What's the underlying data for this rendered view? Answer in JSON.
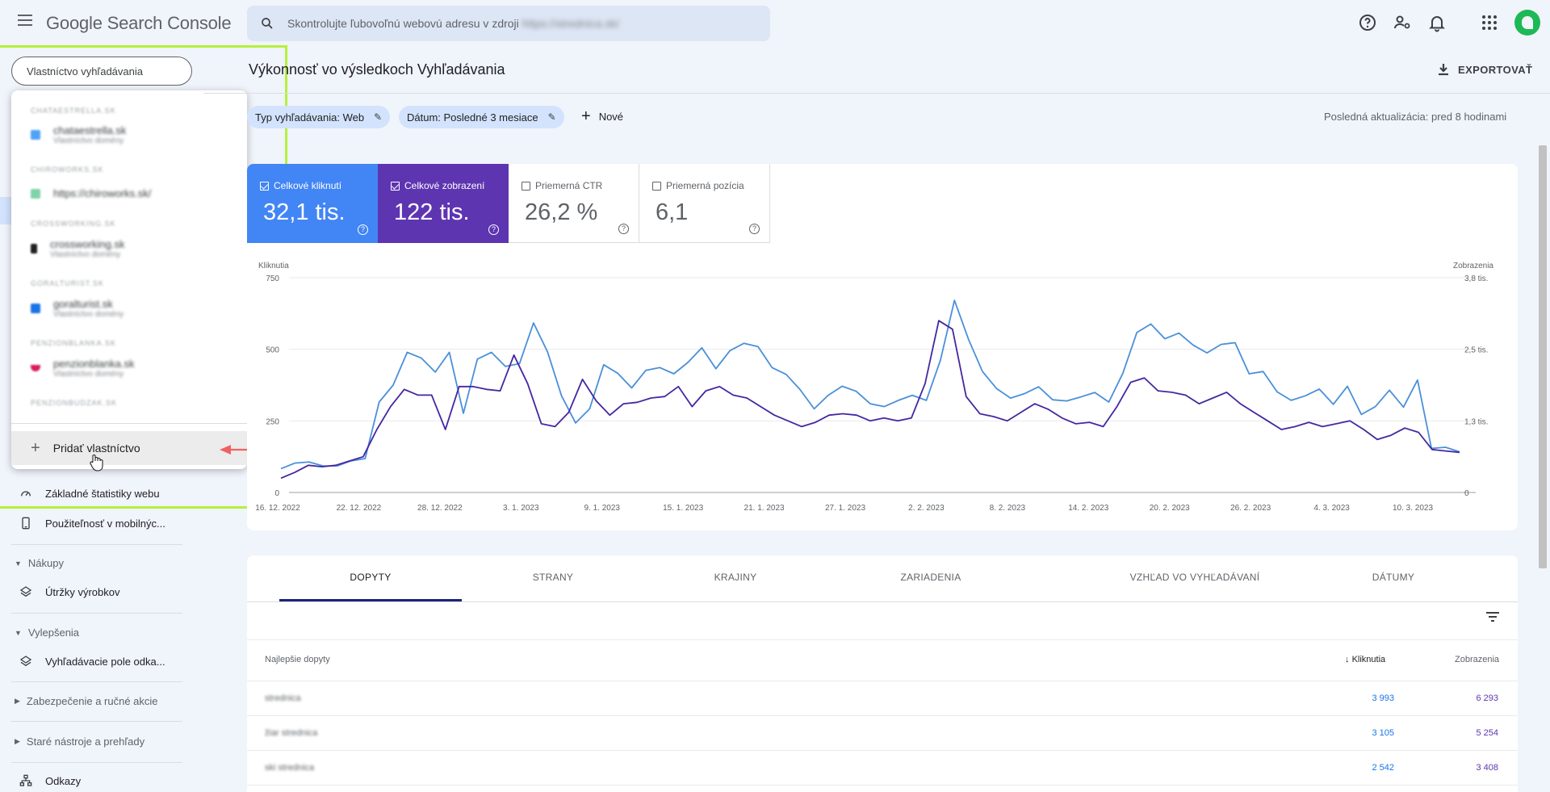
{
  "app": {
    "logo_google": "Google",
    "logo_product": "Search Console"
  },
  "search": {
    "placeholder": "Skontrolujte ľubovoľnú webovú adresu v zdroji",
    "domain": "https://strednica.sk/"
  },
  "sidebar": {
    "property_select": "Vlastníctvo vyhľadávania",
    "items": [
      {
        "label": "Základné štatistiky webu",
        "icon": "speed-icon"
      },
      {
        "label": "Použiteľnosť v mobilnýc...",
        "icon": "phone-icon"
      }
    ],
    "sections": [
      {
        "label": "Nákupy",
        "expanded": true,
        "items": [
          {
            "label": "Útržky výrobkov",
            "icon": "layers-icon"
          }
        ]
      },
      {
        "label": "Vylepšenia",
        "expanded": true,
        "items": [
          {
            "label": "Vyhľadávacie pole odka...",
            "icon": "layers-icon"
          }
        ]
      },
      {
        "label": "Zabezpečenie a ručné akcie",
        "expanded": false,
        "items": []
      },
      {
        "label": "Staré nástroje a prehľady",
        "expanded": false,
        "items": []
      }
    ],
    "bottom_item": {
      "label": "Odkazy",
      "icon": "sitemap-icon"
    }
  },
  "dropdown": {
    "groups": [
      {
        "header": "CHATAESTRELLA.SK",
        "name": "chataestrella.sk",
        "sub": "Vlastníctvo domény",
        "color": "#4fa3f7"
      },
      {
        "header": "CHIROWORKS.SK",
        "name": "https://chiroworks.sk/",
        "sub": "",
        "color": "#34a853"
      },
      {
        "header": "CROSSWORKING.SK",
        "name": "crossworking.sk",
        "sub": "Vlastníctvo domény",
        "color": "#202124"
      },
      {
        "header": "GORALTURIST.SK",
        "name": "goralturist.sk",
        "sub": "Vlastníctvo domény",
        "color": "#1a73e8"
      },
      {
        "header": "PENZIONBLANKA.SK",
        "name": "penzionblanka.sk",
        "sub": "Vlastníctvo domény",
        "color": "#c2185b"
      },
      {
        "header": "PENZIONBUDZAK.SK",
        "name": "",
        "sub": "",
        "color": "#9aa0a6"
      }
    ],
    "add_label": "Pridať vlastníctvo"
  },
  "main": {
    "title": "Výkonnosť vo výsledkoch Vyhľadávania",
    "export": "EXPORTOVAŤ",
    "filters": [
      {
        "label": "Typ vyhľadávania: Web"
      },
      {
        "label": "Dátum: Posledné 3 mesiace"
      }
    ],
    "new_label": "Nové",
    "last_update": "Posledná aktualizácia: pred 8 hodinami"
  },
  "metrics": [
    {
      "label": "Celkové kliknutí",
      "value": "32,1 tis.",
      "checked": true
    },
    {
      "label": "Celkové zobrazení",
      "value": "122 tis.",
      "checked": true
    },
    {
      "label": "Priemerná CTR",
      "value": "26,2 %",
      "checked": false
    },
    {
      "label": "Priemerná pozícia",
      "value": "6,1",
      "checked": false
    }
  ],
  "chart_data": {
    "type": "line",
    "left_axis_label": "Kliknutia",
    "right_axis_label": "Zobrazenia",
    "left_ticks": [
      "0",
      "250",
      "500",
      "750"
    ],
    "right_ticks": [
      "0",
      "1,3 tis.",
      "2,5 tis.",
      "3,8 tis."
    ],
    "ylim_left": [
      0,
      750
    ],
    "ylim_right": [
      0,
      3800
    ],
    "x_labels": [
      "16. 12. 2022",
      "22. 12. 2022",
      "28. 12. 2022",
      "3. 1. 2023",
      "9. 1. 2023",
      "15. 1. 2023",
      "21. 1. 2023",
      "27. 1. 2023",
      "2. 2. 2023",
      "8. 2. 2023",
      "14. 2. 2023",
      "20. 2. 2023",
      "26. 2. 2023",
      "4. 3. 2023",
      "10. 3. 2023"
    ],
    "grid": true,
    "series": [
      {
        "name": "Zobrazenia",
        "color": "#4a90d9",
        "axis": "right",
        "values": [
          420,
          520,
          540,
          470,
          470,
          560,
          600,
          1600,
          1900,
          2480,
          2380,
          2130,
          2480,
          1400,
          2360,
          2480,
          2230,
          2280,
          3000,
          2490,
          1710,
          1230,
          1480,
          2260,
          2110,
          1850,
          2160,
          2210,
          2100,
          2300,
          2560,
          2190,
          2510,
          2640,
          2580,
          2210,
          2090,
          1820,
          1480,
          1720,
          1880,
          1790,
          1570,
          1520,
          1630,
          1720,
          1630,
          2340,
          3400,
          2710,
          2140,
          1840,
          1670,
          1750,
          1870,
          1640,
          1620,
          1690,
          1770,
          1600,
          2110,
          2830,
          2980,
          2720,
          2820,
          2610,
          2470,
          2620,
          2650,
          2100,
          2140,
          1780,
          1630,
          1710,
          1830,
          1560,
          1880,
          1380,
          1520,
          1810,
          1510,
          1990,
          780,
          800,
          720
        ]
      },
      {
        "name": "Kliknutia",
        "color": "#4527a0",
        "axis": "left",
        "values": [
          50,
          70,
          95,
          90,
          95,
          110,
          125,
          220,
          300,
          360,
          340,
          340,
          220,
          370,
          370,
          360,
          355,
          480,
          380,
          240,
          230,
          280,
          395,
          320,
          270,
          310,
          315,
          330,
          335,
          370,
          300,
          355,
          370,
          340,
          330,
          300,
          270,
          250,
          230,
          245,
          270,
          275,
          270,
          250,
          260,
          250,
          260,
          380,
          600,
          570,
          335,
          275,
          265,
          250,
          280,
          310,
          290,
          260,
          240,
          245,
          230,
          300,
          385,
          400,
          355,
          350,
          340,
          310,
          330,
          350,
          310,
          280,
          250,
          220,
          230,
          245,
          230,
          240,
          250,
          220,
          185,
          200,
          225,
          210,
          150,
          145,
          140
        ]
      }
    ]
  },
  "table": {
    "tabs": [
      "DOPYTY",
      "STRANY",
      "KRAJINY",
      "ZARIADENIA",
      "VZHĽAD VO VYHĽADÁVANÍ",
      "DÁTUMY"
    ],
    "col_query": "Najlepšie dopyty",
    "col_clicks": "Kliknutia",
    "col_impressions": "Zobrazenia",
    "rows": [
      {
        "query": "strednica",
        "clicks": "3 993",
        "impressions": "6 293"
      },
      {
        "query": "žiar strednica",
        "clicks": "3 105",
        "impressions": "5 254"
      },
      {
        "query": "ski strednica",
        "clicks": "2 542",
        "impressions": "3 408"
      }
    ]
  }
}
